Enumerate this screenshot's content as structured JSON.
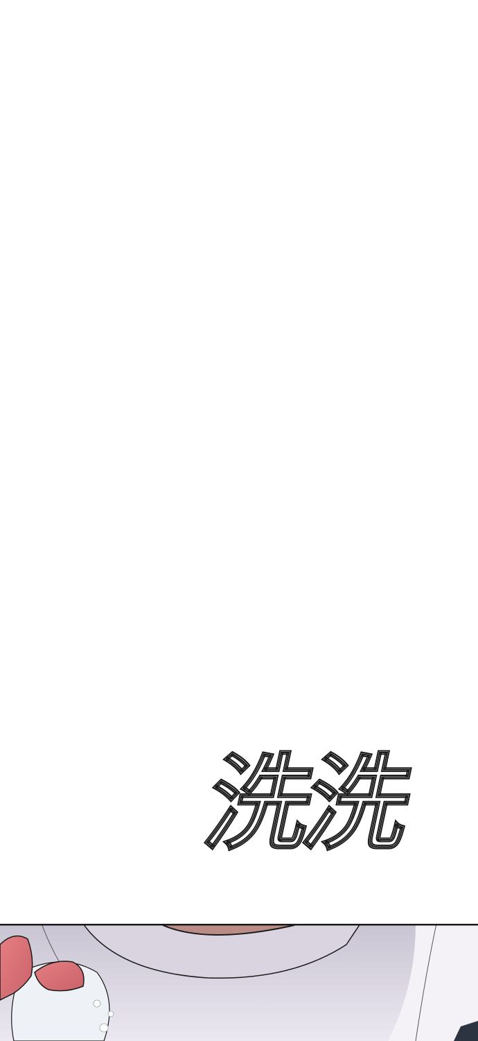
{
  "sound_effect": {
    "text": "洗洗",
    "fill_color": "#ffffff",
    "outline_color": "#1a1a1a"
  },
  "panel": {
    "colors": {
      "background": "#ffffff",
      "skin_shadow": "#cfcad7",
      "skin_light": "#eae6ef",
      "mouth": "#b98c86",
      "hand": "#e07b7d",
      "hand_shadow": "#c85c63",
      "line": "#1a1a1a",
      "dark_garment": "#2c3442"
    }
  }
}
